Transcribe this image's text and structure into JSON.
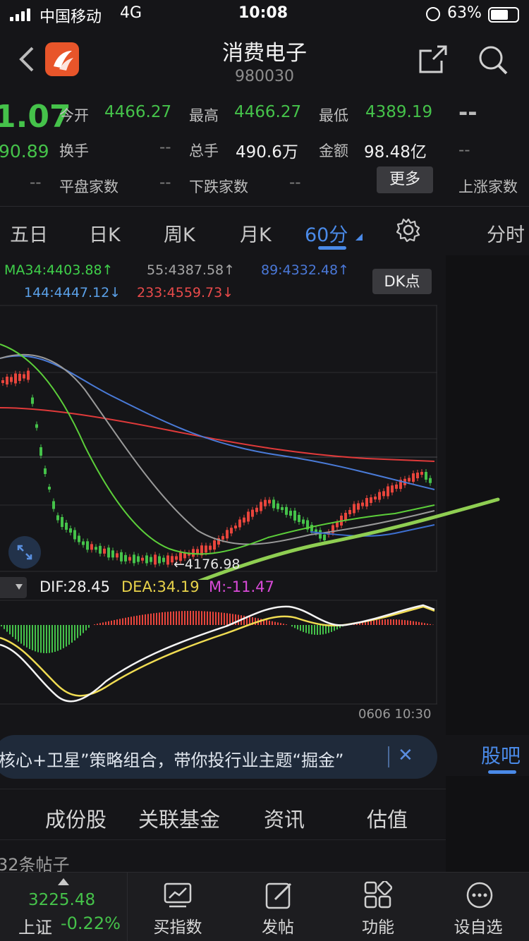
{
  "status_bar": {
    "carrier": "中国移动",
    "network": "4G",
    "time": "10:08",
    "battery": "63%"
  },
  "header": {
    "title": "消费电子",
    "code": "980030"
  },
  "quote": {
    "price_partial": "1.07",
    "change_partial": "90.89",
    "open_label": "今开",
    "open": "4466.27",
    "high_label": "最高",
    "high": "4466.27",
    "low_label": "最低",
    "low": "4389.19",
    "dash_big": "--",
    "turnover_label": "换手",
    "turnover": "--",
    "volume_label": "总手",
    "volume": "490.6万",
    "amount_label": "金额",
    "amount": "98.48亿",
    "dash_right": "--",
    "flat_value": "--",
    "flat_label": "平盘家数",
    "down_value": "--",
    "down_label": "下跌家数",
    "unchanged_value": "--",
    "more_label": "更多",
    "up_label": "上涨家数"
  },
  "tabs": {
    "five_day": "五日",
    "day_k": "日K",
    "week_k": "周K",
    "month_k": "月K",
    "min60": "60分",
    "intraday": "分时"
  },
  "ma_legend": {
    "ma34": "MA34:4403.88↑",
    "ma55": "55:4387.58↑",
    "ma89": "89:4332.48↑",
    "ma144": "144:4447.12↓",
    "ma233": "233:4559.73↓"
  },
  "dk_button": "DK点",
  "min_marker": "←4176.98",
  "macd": {
    "dif": "DIF:28.45",
    "dea": "DEA:34.19",
    "m": "M:-11.47"
  },
  "time_axis_label": "0606 10:30",
  "banner": {
    "text": "核心+卫星”策略组合，带你投行业主题“掘金”"
  },
  "guba_tab": "股吧",
  "subtabs": {
    "components": "成份股",
    "funds": "关联基金",
    "news": "资讯",
    "valuation": "估值"
  },
  "post_count": "32条帖子",
  "bottom_bar": {
    "index_value": "3225.48",
    "index_name": "上证",
    "index_change": "-0.22%",
    "buy_index": "买指数",
    "post": "发帖",
    "functions": "功能",
    "add_watch": "设自选"
  },
  "colors": {
    "up": "#e8453c",
    "down": "#45c24a",
    "accent": "#4a8ae8",
    "background": "#151518"
  }
}
